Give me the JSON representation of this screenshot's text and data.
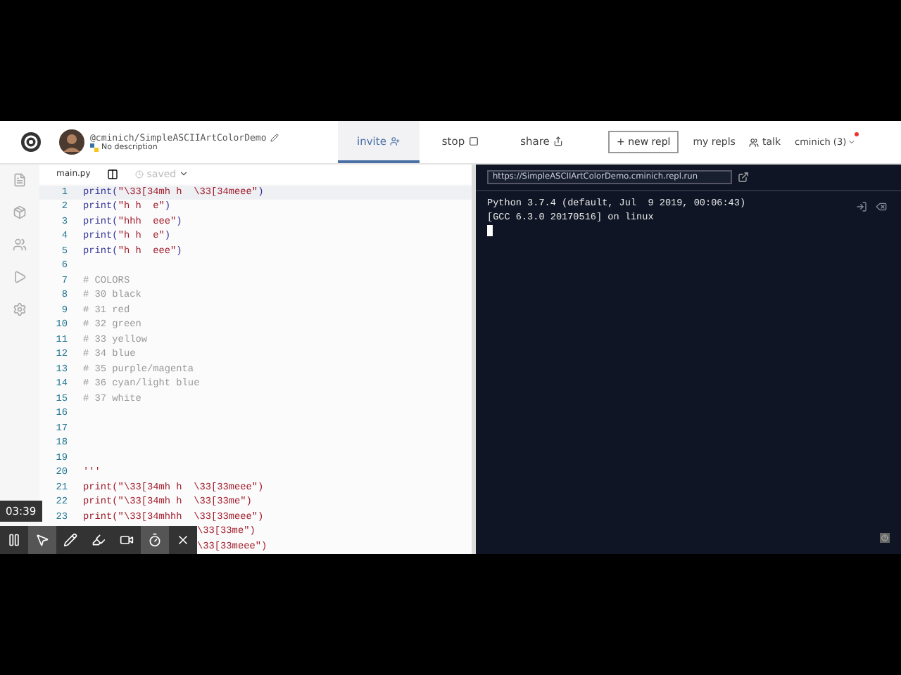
{
  "header": {
    "repo": "@cminich/SimpleASCIIArtColorDemo",
    "description": "No description",
    "tabs": [
      {
        "label": "invite",
        "selected": true
      },
      {
        "label": "stop",
        "selected": false
      },
      {
        "label": "share",
        "selected": false
      }
    ],
    "new_button": "+ new repl",
    "links": [
      "my repls",
      "talk"
    ],
    "user": "cminich (3)",
    "notification": true
  },
  "editor": {
    "file_tab": "main.py",
    "save_status": "saved",
    "lines": [
      {
        "number": "1",
        "kind": "code",
        "segments": [
          {
            "kind": "fn",
            "text": "print("
          },
          {
            "kind": "str",
            "text": "\"\\33[34mh h  \\33[34meee\""
          },
          {
            "kind": "fn",
            "text": ")"
          }
        ]
      },
      {
        "number": "2",
        "kind": "code",
        "segments": [
          {
            "kind": "fn",
            "text": "print("
          },
          {
            "kind": "str",
            "text": "\"h h  e\""
          },
          {
            "kind": "fn",
            "text": ")"
          }
        ]
      },
      {
        "number": "3",
        "kind": "code",
        "segments": [
          {
            "kind": "fn",
            "text": "print("
          },
          {
            "kind": "str",
            "text": "\"hhh  eee\""
          },
          {
            "kind": "fn",
            "text": ")"
          }
        ]
      },
      {
        "number": "4",
        "kind": "code",
        "segments": [
          {
            "kind": "fn",
            "text": "print("
          },
          {
            "kind": "str",
            "text": "\"h h  e\""
          },
          {
            "kind": "fn",
            "text": ")"
          }
        ]
      },
      {
        "number": "5",
        "kind": "code",
        "segments": [
          {
            "kind": "fn",
            "text": "print("
          },
          {
            "kind": "str",
            "text": "\"h h  eee\""
          },
          {
            "kind": "fn",
            "text": ")"
          }
        ]
      },
      {
        "number": "6",
        "kind": "code"
      },
      {
        "number": "7",
        "kind": "code",
        "segments": [
          {
            "kind": "comment",
            "text": "# COLORS"
          }
        ]
      },
      {
        "number": "8",
        "kind": "code",
        "segments": [
          {
            "kind": "comment",
            "text": "# 30 black"
          }
        ]
      },
      {
        "number": "9",
        "kind": "code",
        "segments": [
          {
            "kind": "comment",
            "text": "# 31 red"
          }
        ]
      },
      {
        "number": "10",
        "kind": "code",
        "segments": [
          {
            "kind": "comment",
            "text": "# 32 green"
          }
        ]
      },
      {
        "number": "11",
        "kind": "code",
        "segments": [
          {
            "kind": "comment",
            "text": "# 33 yellow"
          }
        ]
      },
      {
        "number": "12",
        "kind": "code",
        "segments": [
          {
            "kind": "comment",
            "text": "# 34 blue"
          }
        ]
      },
      {
        "number": "13",
        "kind": "code",
        "segments": [
          {
            "kind": "comment",
            "text": "# 35 purple/magenta"
          }
        ]
      },
      {
        "number": "14",
        "kind": "code",
        "segments": [
          {
            "kind": "comment",
            "text": "# 36 cyan/light blue"
          }
        ]
      },
      {
        "number": "15",
        "kind": "code",
        "segments": [
          {
            "kind": "comment",
            "text": "# 37 white"
          }
        ]
      },
      {
        "number": "16",
        "kind": "code"
      },
      {
        "number": "17",
        "kind": "code"
      },
      {
        "number": "18",
        "kind": "code"
      },
      {
        "number": "19",
        "kind": "code"
      },
      {
        "number": "20",
        "kind": "code",
        "segments": [
          {
            "kind": "str",
            "text": "'''"
          }
        ]
      },
      {
        "number": "21",
        "kind": "code",
        "segments": [
          {
            "kind": "str",
            "text": "print(\"\\33[34mh h  \\33[33meee\")"
          }
        ]
      },
      {
        "number": "22",
        "kind": "code",
        "segments": [
          {
            "kind": "str",
            "text": "print(\"\\33[34mh h  \\33[33me\")"
          }
        ]
      },
      {
        "number": "23",
        "kind": "code",
        "segments": [
          {
            "kind": "str",
            "text": "print(\"\\33[34mhhh  \\33[33meee\")"
          }
        ]
      },
      {
        "kind": "covered",
        "segments": [
          {
            "kind": "str",
            "text": "\\33[33me\")"
          }
        ]
      },
      {
        "kind": "covered",
        "segments": [
          {
            "kind": "str",
            "text": "\\33[33meee\")"
          }
        ]
      }
    ]
  },
  "terminal": {
    "url": "https://SimpleASCIIArtColorDemo.cminich.repl.run",
    "output": [
      "Python 3.7.4 (default, Jul  9 2019, 00:06:43)",
      "[GCC 6.3.0 20170516] on linux"
    ]
  },
  "recorder": {
    "time": "03:39",
    "tools": [
      {
        "selected": false
      },
      {
        "selected": true
      },
      {
        "selected": false
      },
      {
        "selected": false
      },
      {
        "selected": false
      },
      {
        "selected": true
      },
      {
        "selected": false
      }
    ]
  }
}
